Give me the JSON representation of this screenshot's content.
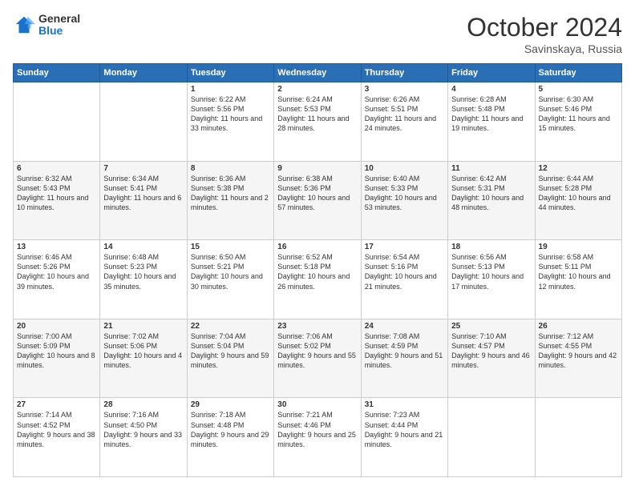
{
  "logo": {
    "general": "General",
    "blue": "Blue"
  },
  "header": {
    "month": "October 2024",
    "location": "Savinskaya, Russia"
  },
  "weekdays": [
    "Sunday",
    "Monday",
    "Tuesday",
    "Wednesday",
    "Thursday",
    "Friday",
    "Saturday"
  ],
  "weeks": [
    [
      {
        "day": "",
        "info": ""
      },
      {
        "day": "",
        "info": ""
      },
      {
        "day": "1",
        "info": "Sunrise: 6:22 AM\nSunset: 5:56 PM\nDaylight: 11 hours and 33 minutes."
      },
      {
        "day": "2",
        "info": "Sunrise: 6:24 AM\nSunset: 5:53 PM\nDaylight: 11 hours and 28 minutes."
      },
      {
        "day": "3",
        "info": "Sunrise: 6:26 AM\nSunset: 5:51 PM\nDaylight: 11 hours and 24 minutes."
      },
      {
        "day": "4",
        "info": "Sunrise: 6:28 AM\nSunset: 5:48 PM\nDaylight: 11 hours and 19 minutes."
      },
      {
        "day": "5",
        "info": "Sunrise: 6:30 AM\nSunset: 5:46 PM\nDaylight: 11 hours and 15 minutes."
      }
    ],
    [
      {
        "day": "6",
        "info": "Sunrise: 6:32 AM\nSunset: 5:43 PM\nDaylight: 11 hours and 10 minutes."
      },
      {
        "day": "7",
        "info": "Sunrise: 6:34 AM\nSunset: 5:41 PM\nDaylight: 11 hours and 6 minutes."
      },
      {
        "day": "8",
        "info": "Sunrise: 6:36 AM\nSunset: 5:38 PM\nDaylight: 11 hours and 2 minutes."
      },
      {
        "day": "9",
        "info": "Sunrise: 6:38 AM\nSunset: 5:36 PM\nDaylight: 10 hours and 57 minutes."
      },
      {
        "day": "10",
        "info": "Sunrise: 6:40 AM\nSunset: 5:33 PM\nDaylight: 10 hours and 53 minutes."
      },
      {
        "day": "11",
        "info": "Sunrise: 6:42 AM\nSunset: 5:31 PM\nDaylight: 10 hours and 48 minutes."
      },
      {
        "day": "12",
        "info": "Sunrise: 6:44 AM\nSunset: 5:28 PM\nDaylight: 10 hours and 44 minutes."
      }
    ],
    [
      {
        "day": "13",
        "info": "Sunrise: 6:46 AM\nSunset: 5:26 PM\nDaylight: 10 hours and 39 minutes."
      },
      {
        "day": "14",
        "info": "Sunrise: 6:48 AM\nSunset: 5:23 PM\nDaylight: 10 hours and 35 minutes."
      },
      {
        "day": "15",
        "info": "Sunrise: 6:50 AM\nSunset: 5:21 PM\nDaylight: 10 hours and 30 minutes."
      },
      {
        "day": "16",
        "info": "Sunrise: 6:52 AM\nSunset: 5:18 PM\nDaylight: 10 hours and 26 minutes."
      },
      {
        "day": "17",
        "info": "Sunrise: 6:54 AM\nSunset: 5:16 PM\nDaylight: 10 hours and 21 minutes."
      },
      {
        "day": "18",
        "info": "Sunrise: 6:56 AM\nSunset: 5:13 PM\nDaylight: 10 hours and 17 minutes."
      },
      {
        "day": "19",
        "info": "Sunrise: 6:58 AM\nSunset: 5:11 PM\nDaylight: 10 hours and 12 minutes."
      }
    ],
    [
      {
        "day": "20",
        "info": "Sunrise: 7:00 AM\nSunset: 5:09 PM\nDaylight: 10 hours and 8 minutes."
      },
      {
        "day": "21",
        "info": "Sunrise: 7:02 AM\nSunset: 5:06 PM\nDaylight: 10 hours and 4 minutes."
      },
      {
        "day": "22",
        "info": "Sunrise: 7:04 AM\nSunset: 5:04 PM\nDaylight: 9 hours and 59 minutes."
      },
      {
        "day": "23",
        "info": "Sunrise: 7:06 AM\nSunset: 5:02 PM\nDaylight: 9 hours and 55 minutes."
      },
      {
        "day": "24",
        "info": "Sunrise: 7:08 AM\nSunset: 4:59 PM\nDaylight: 9 hours and 51 minutes."
      },
      {
        "day": "25",
        "info": "Sunrise: 7:10 AM\nSunset: 4:57 PM\nDaylight: 9 hours and 46 minutes."
      },
      {
        "day": "26",
        "info": "Sunrise: 7:12 AM\nSunset: 4:55 PM\nDaylight: 9 hours and 42 minutes."
      }
    ],
    [
      {
        "day": "27",
        "info": "Sunrise: 7:14 AM\nSunset: 4:52 PM\nDaylight: 9 hours and 38 minutes."
      },
      {
        "day": "28",
        "info": "Sunrise: 7:16 AM\nSunset: 4:50 PM\nDaylight: 9 hours and 33 minutes."
      },
      {
        "day": "29",
        "info": "Sunrise: 7:18 AM\nSunset: 4:48 PM\nDaylight: 9 hours and 29 minutes."
      },
      {
        "day": "30",
        "info": "Sunrise: 7:21 AM\nSunset: 4:46 PM\nDaylight: 9 hours and 25 minutes."
      },
      {
        "day": "31",
        "info": "Sunrise: 7:23 AM\nSunset: 4:44 PM\nDaylight: 9 hours and 21 minutes."
      },
      {
        "day": "",
        "info": ""
      },
      {
        "day": "",
        "info": ""
      }
    ]
  ]
}
